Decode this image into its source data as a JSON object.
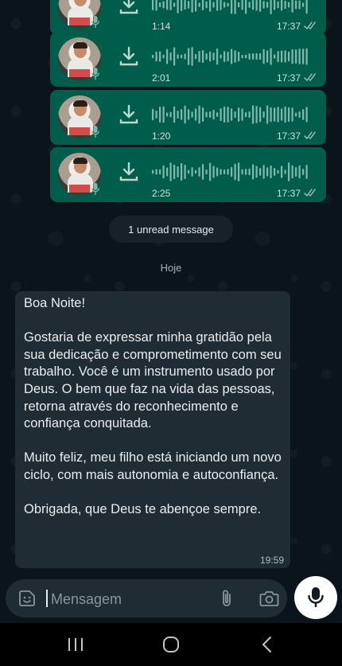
{
  "voice_messages": [
    {
      "duration": "1:14",
      "time": "17:37"
    },
    {
      "duration": "2:01",
      "time": "17:37"
    },
    {
      "duration": "1:20",
      "time": "17:37"
    },
    {
      "duration": "2:25",
      "time": "17:37"
    }
  ],
  "unread_label": "1 unread message",
  "date_divider": "Hoje",
  "message": {
    "text": "Boa Noite!\n\nGostaria de expressar minha gratidão pela sua dedicação e comprometimento com seu trabalho.  Você é um instrumento usado por Deus. O bem que faz na vida das pessoas,  retorna através do reconhecimento e confiança conquitada.\n\nMuito feliz,  meu filho está iniciando um novo ciclo, com mais autonomia e autoconfiança.\n\nObrigada,  que Deus te abençoe sempre.",
    "time": "19:59"
  },
  "composer": {
    "placeholder": "Mensagem"
  },
  "icons": {
    "download": "download-icon",
    "mic": "mic-icon",
    "read_receipt": "double-check-icon",
    "emoji": "sticker-icon",
    "attach": "paperclip-icon",
    "camera": "camera-icon",
    "nav": [
      "recent-apps-icon",
      "home-icon",
      "back-icon"
    ]
  },
  "colors": {
    "outgoing_bubble": "#005c4b",
    "incoming_bubble": "#1f2c33",
    "chat_background": "#0b141a",
    "accent_blue": "#53bdeb"
  }
}
